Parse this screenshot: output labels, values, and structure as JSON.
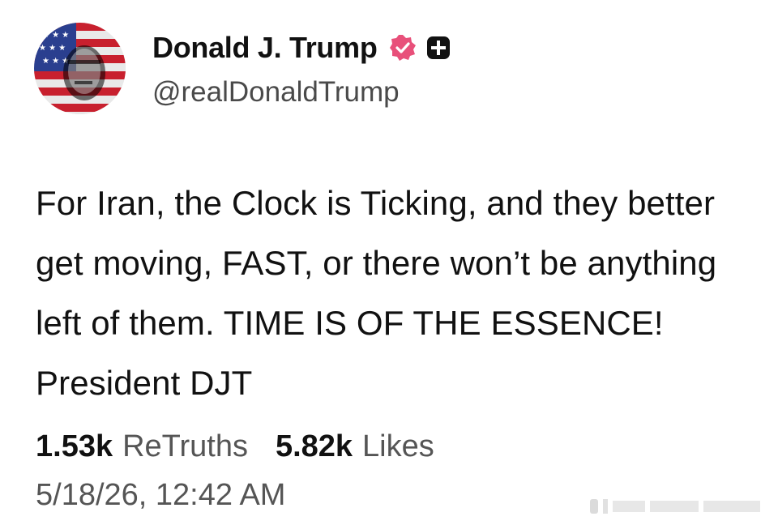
{
  "author": {
    "display_name": "Donald J. Trump",
    "handle": "@realDonaldTrump",
    "avatar_icon": "avatar-portrait-flag",
    "verified_icon": "verified-badge-icon",
    "verified_color": "#e8507a",
    "plus_icon": "plus-badge-icon"
  },
  "post": {
    "text": "For Iran, the Clock is Ticking, and they better get moving, FAST, or there won’t be anything left of them. TIME IS OF THE ESSENCE! President DJT"
  },
  "stats": {
    "retruths_count": "1.53k",
    "retruths_label": "ReTruths",
    "likes_count": "5.82k",
    "likes_label": "Likes"
  },
  "timestamp": "5/18/26, 12:42 AM",
  "colors": {
    "background": "#ffffff",
    "text": "#111111",
    "secondary": "#555555",
    "flag_red": "#c8202e",
    "flag_blue": "#2a3f8f"
  }
}
